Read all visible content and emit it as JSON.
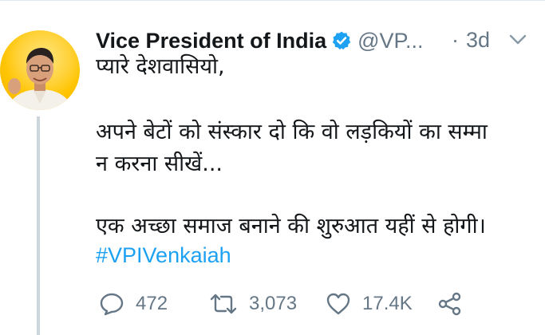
{
  "tweet": {
    "author_name": "Vice President of India",
    "handle": "@VP...",
    "separator": "·",
    "time": "3d",
    "lines": [
      "प्यारे देशवासियो,",
      "अपने बेटों को संस्कार दो कि वो लड़कियों का सम्मा",
      "न करना सीखें...",
      "एक अच्छा समाज बनाने की शुरुआत यहीं से होगी।"
    ],
    "hashtag": "#VPIVenkaiah"
  },
  "actions": {
    "replies": "472",
    "retweets": "3,073",
    "likes": "17.4K"
  },
  "colors": {
    "verified": "#1da1f2",
    "link": "#1da1f2",
    "muted": "#657786",
    "text": "#14171a",
    "avatar_bg": "#ffc400"
  },
  "icons": [
    "verified-badge-icon",
    "chevron-down-icon",
    "reply-icon",
    "retweet-icon",
    "like-icon",
    "share-icon"
  ]
}
